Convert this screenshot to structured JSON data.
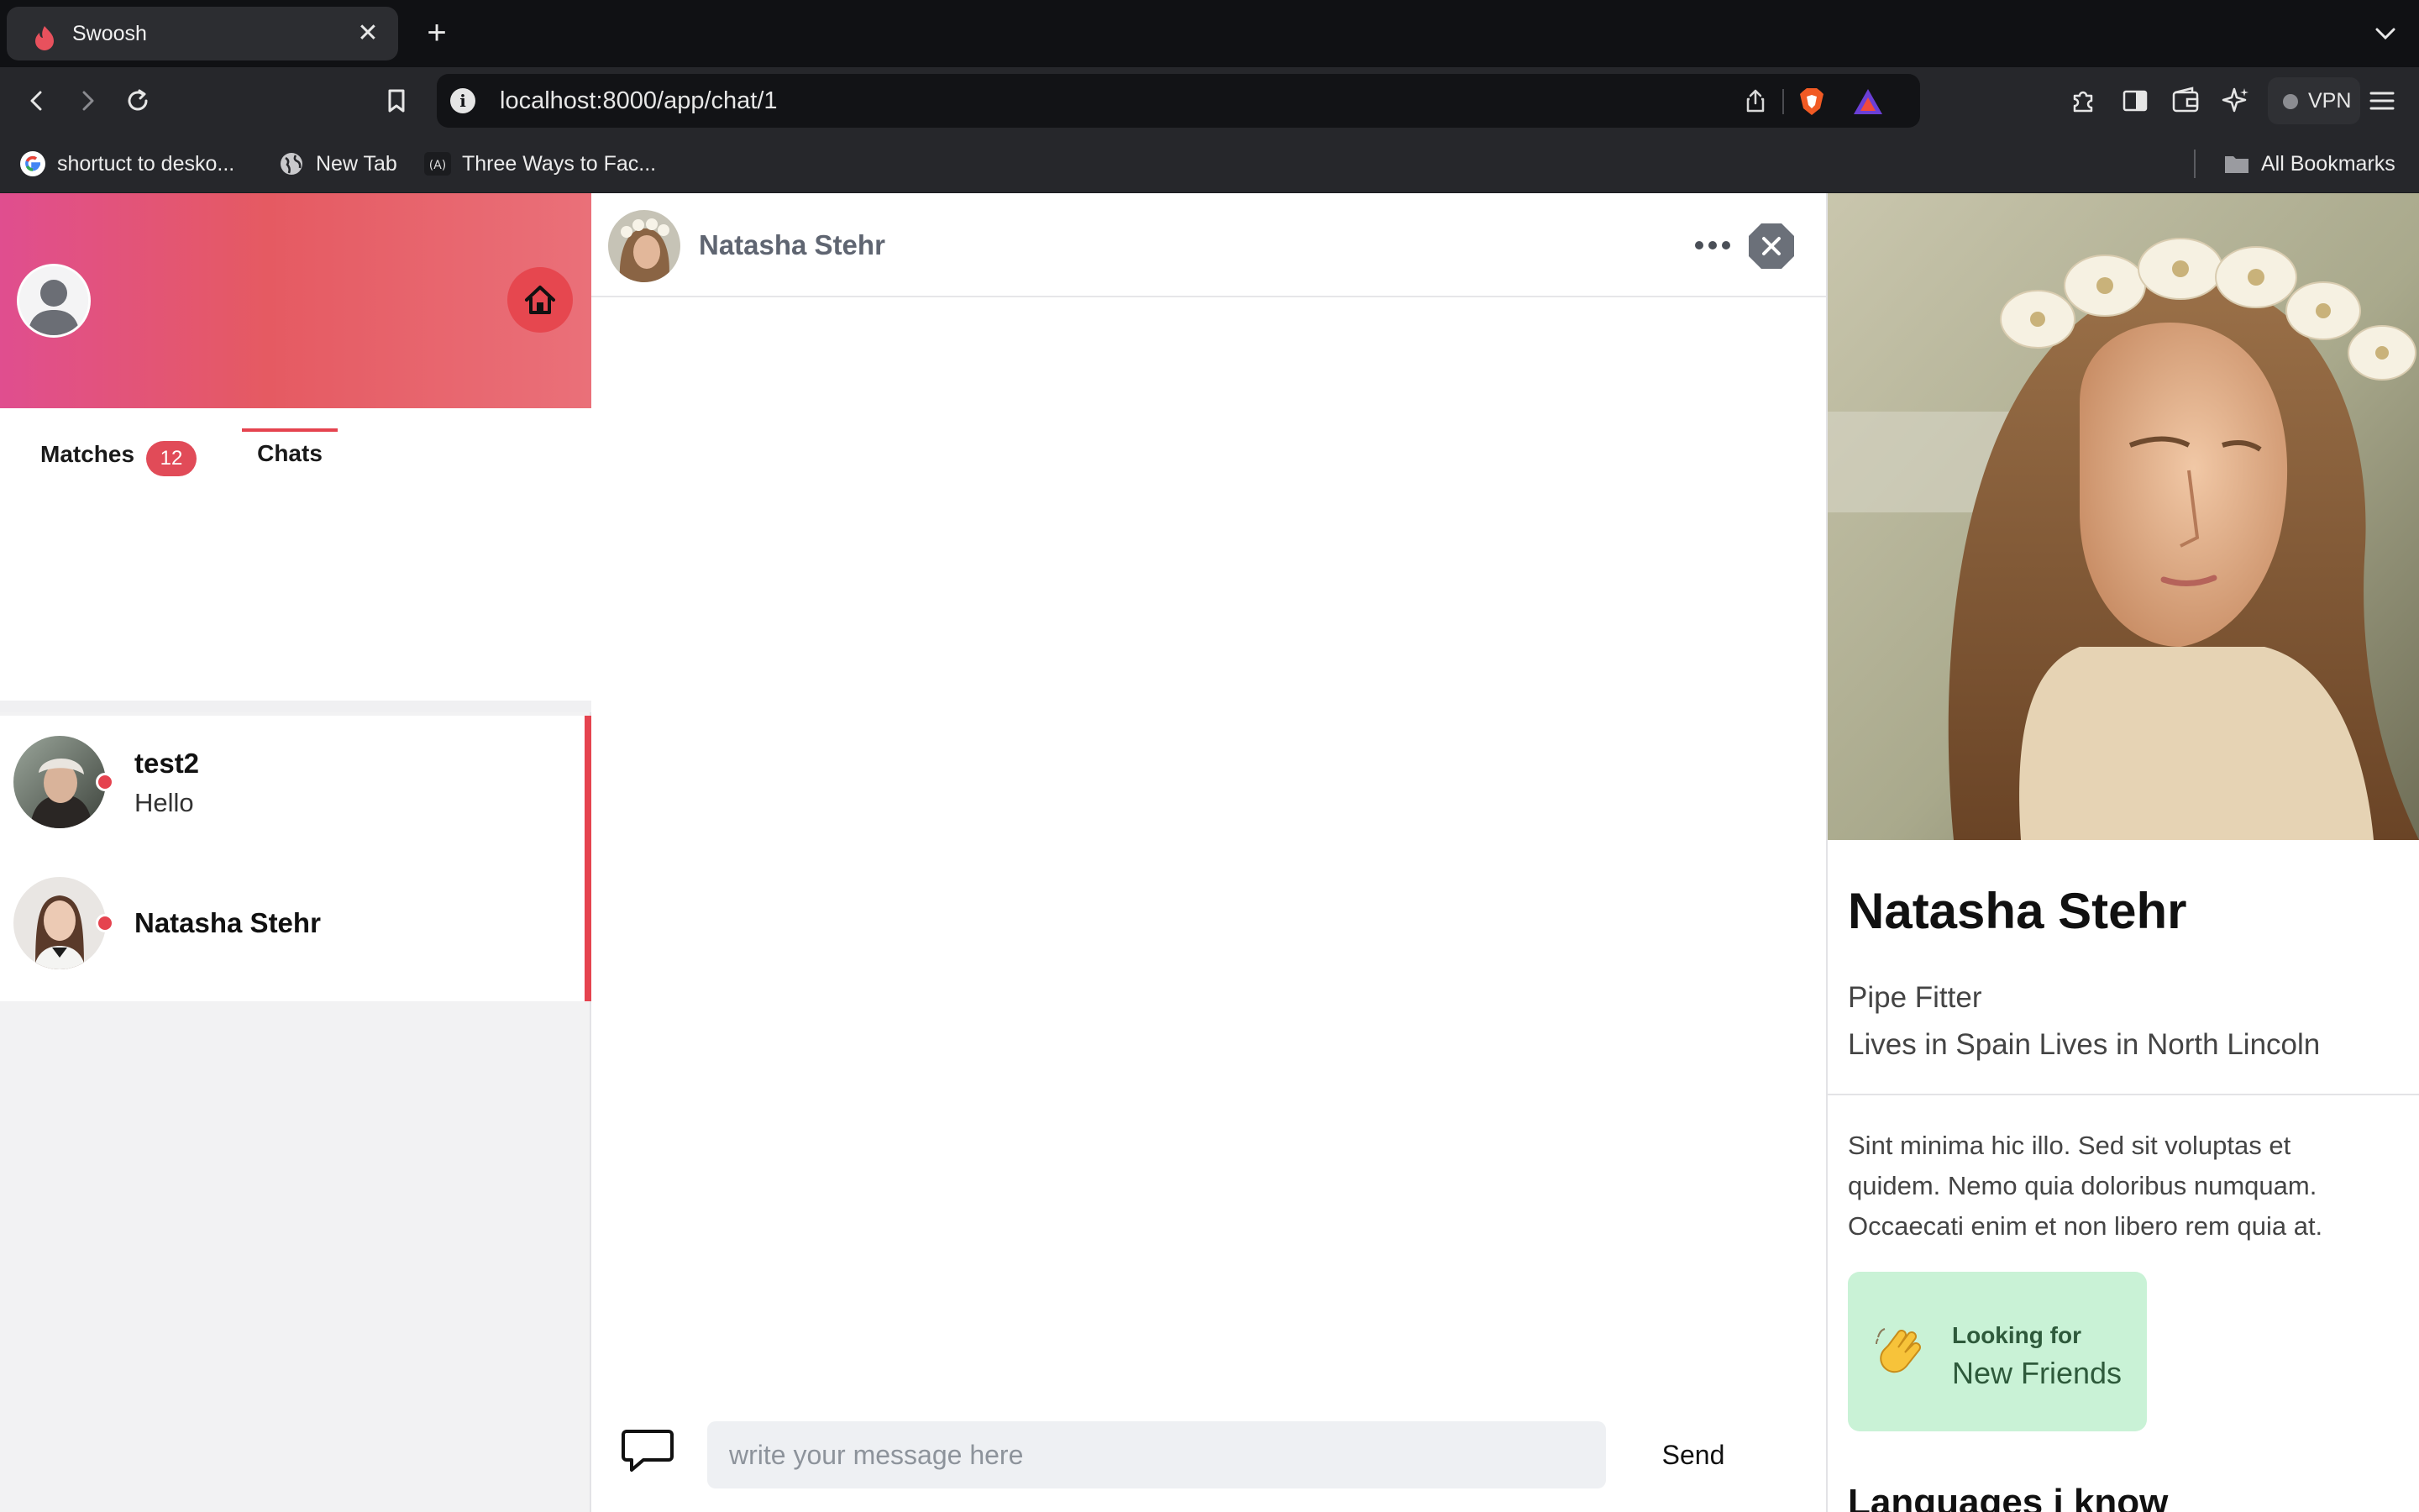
{
  "browser": {
    "tab_title": "Swoosh",
    "url": "localhost:8000/app/chat/1",
    "vpn_label": "VPN",
    "bookmarks": [
      {
        "label": "shortuct to desko...",
        "icon": "google-icon"
      },
      {
        "label": "New Tab",
        "icon": "globe-icon"
      },
      {
        "label": "Three Ways to Fac...",
        "icon": "site-icon"
      }
    ],
    "all_bookmarks_label": "All Bookmarks"
  },
  "sidebar": {
    "tabs": {
      "matches_label": "Matches",
      "matches_count": "12",
      "chats_label": "Chats",
      "active": "Chats"
    },
    "chats": [
      {
        "name": "test2",
        "preview": "Hello",
        "online": true
      },
      {
        "name": "Natasha Stehr",
        "preview": "",
        "online": true
      }
    ]
  },
  "chat": {
    "contact_name": "Natasha Stehr",
    "input_placeholder": "write your message here",
    "input_value": "",
    "send_label": "Send"
  },
  "profile": {
    "name": "Natasha Stehr",
    "occupation": "Pipe Fitter",
    "location": "Lives in Spain Lives in North Lincoln",
    "bio": "Sint minima hic illo. Sed sit voluptas et quidem. Nemo quia doloribus numquam. Occaecati enim et non libero rem quia at.",
    "looking_for_label": "Looking for",
    "looking_for_value": "New Friends",
    "looking_for_icon": "waving-hand-icon",
    "languages_heading": "Languages i know"
  },
  "colors": {
    "accent": "#e5434f",
    "header_gradient_start": "#e04e8f",
    "header_gradient_end": "#ea7079",
    "looking_card_bg": "#c9f2d6"
  }
}
